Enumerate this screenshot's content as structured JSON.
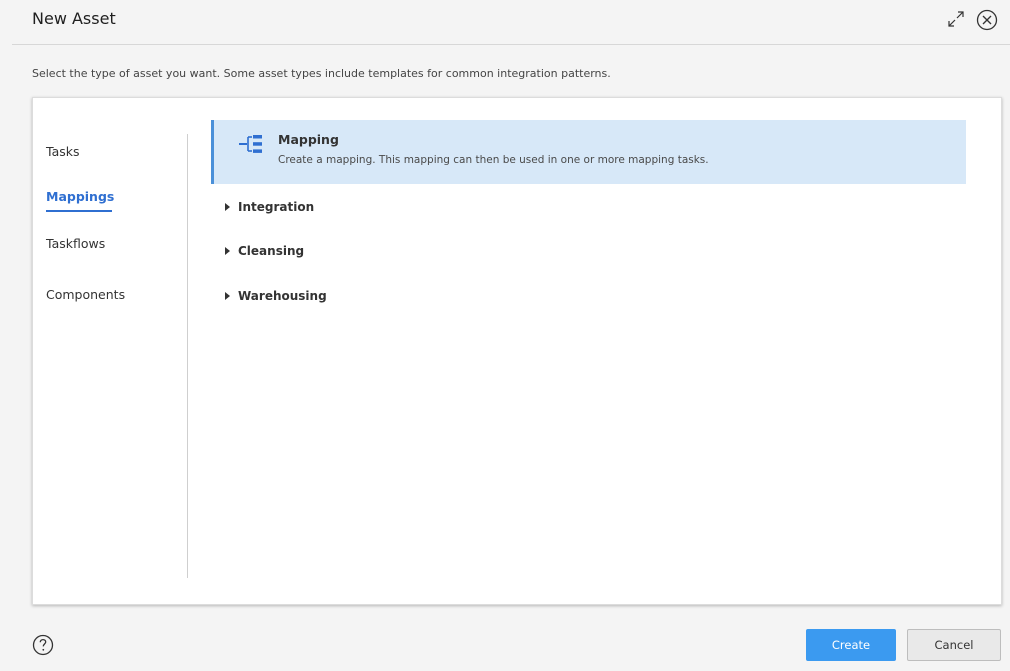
{
  "dialog": {
    "title": "New Asset",
    "description": "Select the type of asset you want. Some asset types include templates for common integration patterns."
  },
  "nav": {
    "items": [
      {
        "label": "Tasks",
        "active": false
      },
      {
        "label": "Mappings",
        "active": true
      },
      {
        "label": "Taskflows",
        "active": false
      },
      {
        "label": "Components",
        "active": false
      }
    ]
  },
  "content": {
    "selected_asset": {
      "name": "Mapping",
      "description": "Create a mapping. This mapping can then be used in one or more mapping tasks.",
      "icon": "mapping-icon"
    },
    "groups": [
      {
        "label": "Integration"
      },
      {
        "label": "Cleansing"
      },
      {
        "label": "Warehousing"
      }
    ]
  },
  "footer": {
    "create_label": "Create",
    "cancel_label": "Cancel"
  },
  "colors": {
    "accent": "#2f6fd1",
    "selection_bg": "#d7e8f8",
    "primary_button": "#3b9af0"
  }
}
